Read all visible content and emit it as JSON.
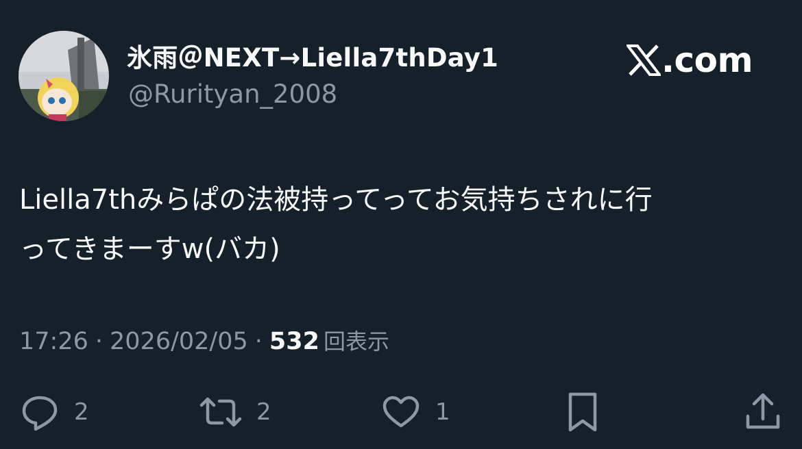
{
  "author": {
    "display_name": "氷雨＠NEXT→Liella7thDay1",
    "handle": "@Rurityan_2008"
  },
  "brand": {
    "text": ".com",
    "logo_icon": "x-logo-icon"
  },
  "tweet": {
    "text": "Liella7thみらぱの法被持ってってお気持ちされに行\nってきまーすw(バカ)"
  },
  "meta": {
    "time": "17:26",
    "separator": "·",
    "date": "2026/02/05",
    "views_count": "532",
    "views_label": "回表示"
  },
  "actions": {
    "reply_count": "2",
    "retweet_count": "2",
    "like_count": "1",
    "reply_icon": "reply-icon",
    "retweet_icon": "retweet-icon",
    "like_icon": "heart-icon",
    "bookmark_icon": "bookmark-icon",
    "share_icon": "share-icon"
  },
  "colors": {
    "background": "#15202b",
    "primary_text": "#f7f9f9",
    "secondary_text": "#8b98a5"
  }
}
